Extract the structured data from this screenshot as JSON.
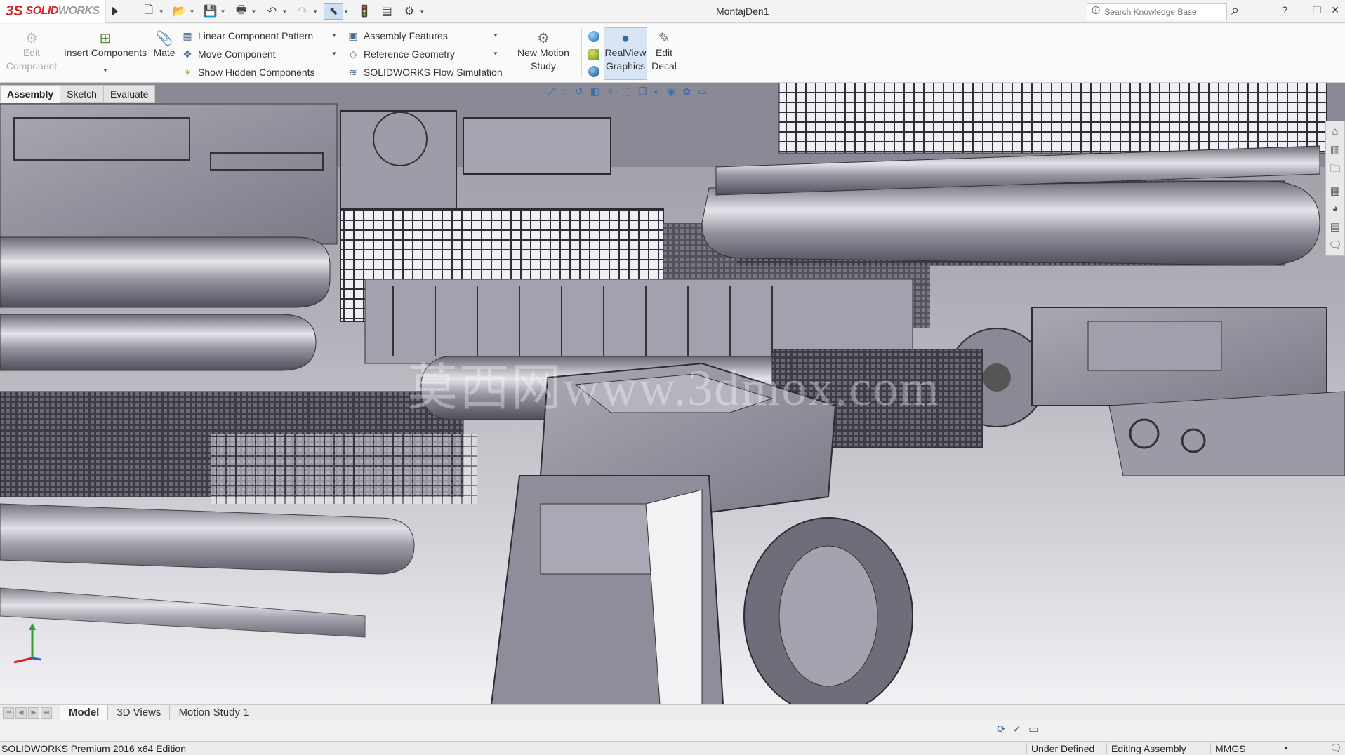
{
  "app": {
    "brand_ds": "3S",
    "brand_solid": "SOLID",
    "brand_works": "WORKS",
    "document_title": "MontajDen1"
  },
  "search": {
    "placeholder": "Search Knowledge Base"
  },
  "window_controls": {
    "help": "?",
    "minimize": "–",
    "restore": "❐",
    "close": "✕"
  },
  "ribbon": {
    "edit_component": {
      "line1": "Edit",
      "line2": "Component"
    },
    "insert_components": "Insert Components",
    "mate": "Mate",
    "linear_component_pattern": "Linear Component Pattern",
    "move_component": "Move Component",
    "show_hidden_components": "Show Hidden Components",
    "assembly_features": "Assembly Features",
    "reference_geometry": "Reference Geometry",
    "flow_simulation": "SOLIDWORKS Flow Simulation",
    "new_motion_study": {
      "line1": "New Motion",
      "line2": "Study"
    },
    "realview_graphics": {
      "line1": "RealView",
      "line2": "Graphics"
    },
    "edit_decal": {
      "line1": "Edit",
      "line2": "Decal"
    }
  },
  "command_tabs": [
    "Assembly",
    "Sketch",
    "Evaluate"
  ],
  "viewport": {
    "watermark": "莫西网www.3dmox.com"
  },
  "bottom_tabs": [
    "Model",
    "3D Views",
    "Motion Study 1"
  ],
  "status": {
    "edition": "SOLIDWORKS Premium 2016 x64 Edition",
    "definition": "Under Defined",
    "mode": "Editing Assembly",
    "units": "MMGS"
  },
  "colors": {
    "brand_red": "#d2232a",
    "accent_blue": "#3d6ea8",
    "selection_bg": "#d6e4f3"
  }
}
